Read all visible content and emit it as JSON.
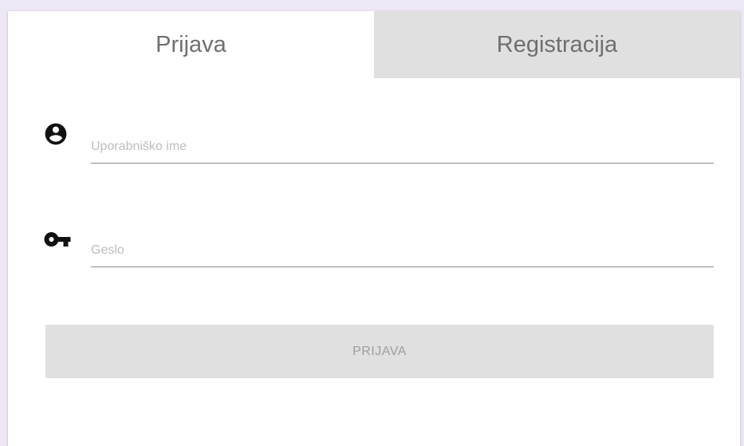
{
  "tabs": [
    {
      "label": "Prijava",
      "active": true
    },
    {
      "label": "Registracija",
      "active": false
    }
  ],
  "form": {
    "username": {
      "icon": "account-circle-icon",
      "placeholder": "Uporabniško ime",
      "value": ""
    },
    "password": {
      "icon": "key-icon",
      "placeholder": "Geslo",
      "value": ""
    },
    "submit_label": "PRIJAVA"
  },
  "colors": {
    "page_background": "#ede7f6",
    "inactive_tab": "#e0e0e0",
    "button_background": "#e0e0e0",
    "button_text": "#9e9e9e"
  }
}
